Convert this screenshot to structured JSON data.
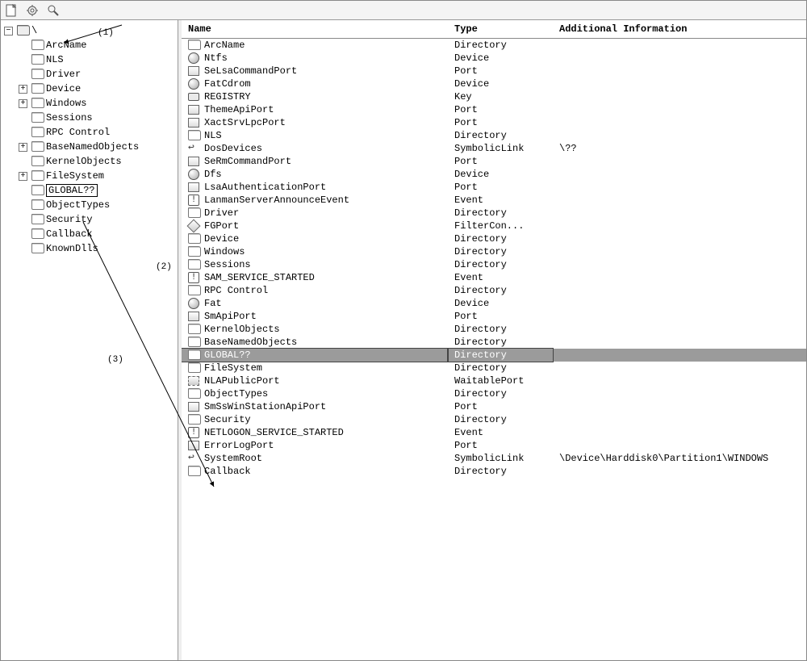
{
  "toolbar": {
    "icons": [
      "file-icon",
      "gear-icon",
      "search-icon"
    ]
  },
  "annotations": {
    "a1": "(1)",
    "a2": "(2)",
    "a3": "(3)"
  },
  "tree": {
    "root_label": "\\",
    "items": [
      {
        "label": "ArcName",
        "expander": ""
      },
      {
        "label": "NLS",
        "expander": ""
      },
      {
        "label": "Driver",
        "expander": ""
      },
      {
        "label": "Device",
        "expander": "+"
      },
      {
        "label": "Windows",
        "expander": "+"
      },
      {
        "label": "Sessions",
        "expander": ""
      },
      {
        "label": "RPC Control",
        "expander": ""
      },
      {
        "label": "BaseNamedObjects",
        "expander": "+"
      },
      {
        "label": "KernelObjects",
        "expander": ""
      },
      {
        "label": "FileSystem",
        "expander": "+"
      },
      {
        "label": "GLOBAL??",
        "expander": "",
        "selected": true
      },
      {
        "label": "ObjectTypes",
        "expander": ""
      },
      {
        "label": "Security",
        "expander": ""
      },
      {
        "label": "Callback",
        "expander": ""
      },
      {
        "label": "KnownDlls",
        "expander": ""
      }
    ]
  },
  "columns": {
    "name": "Name",
    "type": "Type",
    "info": "Additional Information"
  },
  "rows": [
    {
      "icon": "folder",
      "name": "ArcName",
      "type": "Directory",
      "info": ""
    },
    {
      "icon": "device",
      "name": "Ntfs",
      "type": "Device",
      "info": ""
    },
    {
      "icon": "port",
      "name": "SeLsaCommandPort",
      "type": "Port",
      "info": ""
    },
    {
      "icon": "device",
      "name": "FatCdrom",
      "type": "Device",
      "info": ""
    },
    {
      "icon": "key",
      "name": "REGISTRY",
      "type": "Key",
      "info": ""
    },
    {
      "icon": "port",
      "name": "ThemeApiPort",
      "type": "Port",
      "info": ""
    },
    {
      "icon": "port",
      "name": "XactSrvLpcPort",
      "type": "Port",
      "info": ""
    },
    {
      "icon": "folder",
      "name": "NLS",
      "type": "Directory",
      "info": ""
    },
    {
      "icon": "link",
      "name": "DosDevices",
      "type": "SymbolicLink",
      "info": "\\??"
    },
    {
      "icon": "port",
      "name": "SeRmCommandPort",
      "type": "Port",
      "info": ""
    },
    {
      "icon": "device",
      "name": "Dfs",
      "type": "Device",
      "info": ""
    },
    {
      "icon": "port",
      "name": "LsaAuthenticationPort",
      "type": "Port",
      "info": ""
    },
    {
      "icon": "event",
      "name": "LanmanServerAnnounceEvent",
      "type": "Event",
      "info": ""
    },
    {
      "icon": "folder",
      "name": "Driver",
      "type": "Directory",
      "info": ""
    },
    {
      "icon": "filter",
      "name": "FGPort",
      "type": "FilterCon...",
      "info": ""
    },
    {
      "icon": "folder",
      "name": "Device",
      "type": "Directory",
      "info": ""
    },
    {
      "icon": "folder",
      "name": "Windows",
      "type": "Directory",
      "info": ""
    },
    {
      "icon": "folder",
      "name": "Sessions",
      "type": "Directory",
      "info": ""
    },
    {
      "icon": "event",
      "name": "SAM_SERVICE_STARTED",
      "type": "Event",
      "info": ""
    },
    {
      "icon": "folder",
      "name": "RPC Control",
      "type": "Directory",
      "info": ""
    },
    {
      "icon": "device",
      "name": "Fat",
      "type": "Device",
      "info": ""
    },
    {
      "icon": "port",
      "name": "SmApiPort",
      "type": "Port",
      "info": ""
    },
    {
      "icon": "folder",
      "name": "KernelObjects",
      "type": "Directory",
      "info": ""
    },
    {
      "icon": "folder",
      "name": "BaseNamedObjects",
      "type": "Directory",
      "info": ""
    },
    {
      "icon": "folder",
      "name": "GLOBAL??",
      "type": "Directory",
      "info": "",
      "selected": true
    },
    {
      "icon": "folder",
      "name": "FileSystem",
      "type": "Directory",
      "info": ""
    },
    {
      "icon": "waitport",
      "name": "NLAPublicPort",
      "type": "WaitablePort",
      "info": ""
    },
    {
      "icon": "folder",
      "name": "ObjectTypes",
      "type": "Directory",
      "info": ""
    },
    {
      "icon": "port",
      "name": "SmSsWinStationApiPort",
      "type": "Port",
      "info": ""
    },
    {
      "icon": "folder",
      "name": "Security",
      "type": "Directory",
      "info": ""
    },
    {
      "icon": "event",
      "name": "NETLOGON_SERVICE_STARTED",
      "type": "Event",
      "info": ""
    },
    {
      "icon": "port",
      "name": "ErrorLogPort",
      "type": "Port",
      "info": ""
    },
    {
      "icon": "link",
      "name": "SystemRoot",
      "type": "SymbolicLink",
      "info": "\\Device\\Harddisk0\\Partition1\\WINDOWS"
    },
    {
      "icon": "folder",
      "name": "Callback",
      "type": "Directory",
      "info": ""
    }
  ]
}
